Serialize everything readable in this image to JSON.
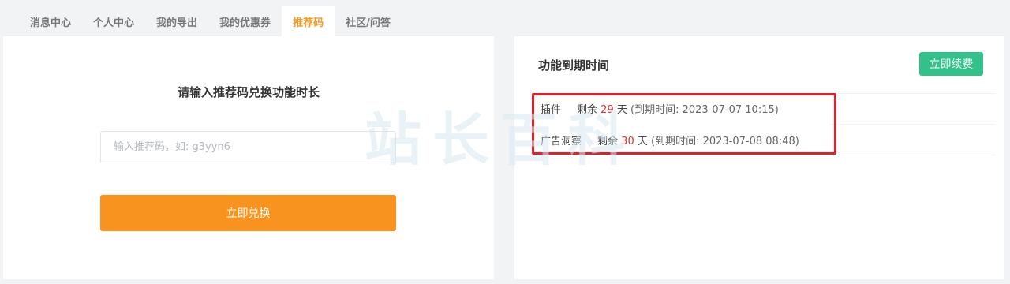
{
  "tabs": [
    {
      "label": "消息中心"
    },
    {
      "label": "个人中心"
    },
    {
      "label": "我的导出"
    },
    {
      "label": "我的优惠券"
    },
    {
      "label": "推荐码",
      "active": true
    },
    {
      "label": "社区/问答"
    }
  ],
  "redeem": {
    "title": "请输入推荐码兑换功能时长",
    "placeholder": "输入推荐码，如: g3yyn6",
    "button_label": "立即兑换"
  },
  "expiry": {
    "title": "功能到期时间",
    "renew_label": "立即续费",
    "items": [
      {
        "name": "插件",
        "remaining_prefix": "剩余",
        "days": "29",
        "unit": "天",
        "detail": "(到期时间: 2023-07-07 10:15)"
      },
      {
        "name": "广告洞察",
        "remaining_prefix": "剩余",
        "days": "30",
        "unit": "天",
        "detail": "(到期时间: 2023-07-08 08:48)"
      }
    ]
  },
  "watermark": "站长百科",
  "colors": {
    "accent_orange": "#f7931e",
    "renew_green": "#33c08a",
    "highlight_red": "#e1202a",
    "days_red": "#e4322f"
  }
}
